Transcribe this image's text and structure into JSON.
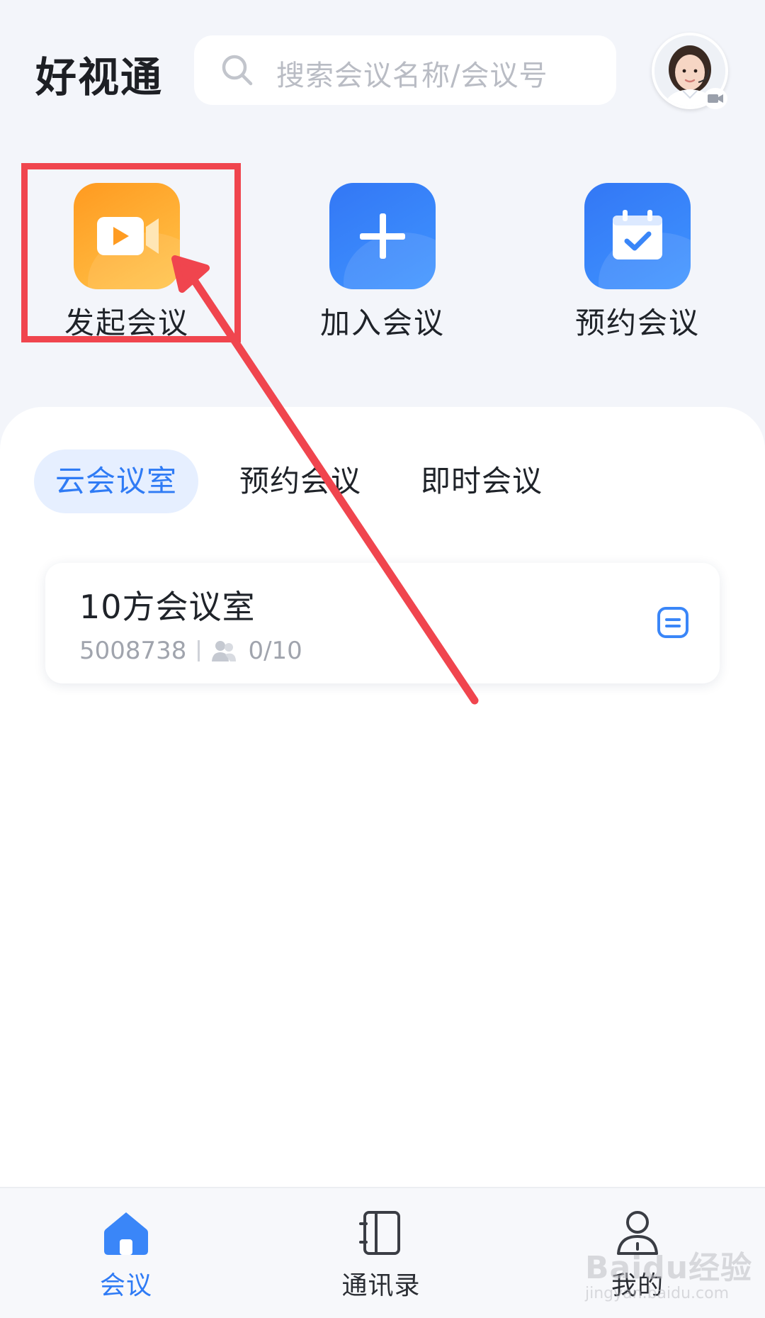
{
  "header": {
    "title": "好视通",
    "search_placeholder": "搜索会议名称/会议号"
  },
  "actions": [
    {
      "label": "发起会议",
      "icon": "video-camera-icon",
      "color": "#ffa928"
    },
    {
      "label": "加入会议",
      "icon": "plus-icon",
      "color": "#3a86f8"
    },
    {
      "label": "预约会议",
      "icon": "calendar-check-icon",
      "color": "#3a86f8"
    }
  ],
  "tabs": [
    {
      "label": "云会议室",
      "active": true
    },
    {
      "label": "预约会议",
      "active": false
    },
    {
      "label": "即时会议",
      "active": false
    }
  ],
  "rooms": [
    {
      "name": "10方会议室",
      "number": "5008738",
      "participants": "0/10"
    }
  ],
  "nav": [
    {
      "label": "会议",
      "icon": "home-icon",
      "active": true
    },
    {
      "label": "通讯录",
      "icon": "contacts-book-icon",
      "active": false
    },
    {
      "label": "我的",
      "icon": "user-profile-icon",
      "active": false
    }
  ],
  "watermark": {
    "text": "Baidu经验",
    "sub": "jingyan.baidu.com"
  },
  "colors": {
    "accent": "#2f7bf5",
    "annotation": "#f0454e",
    "background": "#f3f5fa"
  }
}
